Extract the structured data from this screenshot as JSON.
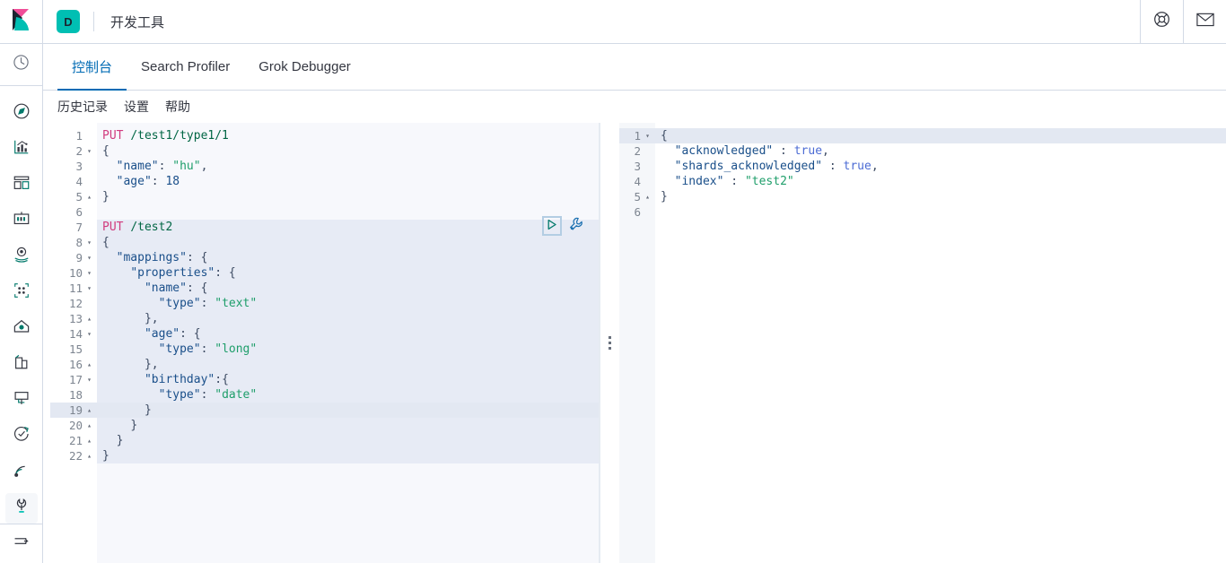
{
  "header": {
    "logo_icon": "kibana-logo-icon",
    "space_badge": "D",
    "app_title": "开发工具",
    "help_icon": "lifebuoy-help-icon",
    "mail_icon": "envelope-icon"
  },
  "sidebar": {
    "recent_icon": "clock-recently-viewed-icon",
    "items": [
      {
        "icon": "compass-discover-icon",
        "name": "discover"
      },
      {
        "icon": "bar-chart-visualize-icon",
        "name": "visualize"
      },
      {
        "icon": "dashboard-icon",
        "name": "dashboard"
      },
      {
        "icon": "canvas-icon",
        "name": "canvas"
      },
      {
        "icon": "map-pin-maps-icon",
        "name": "maps"
      },
      {
        "icon": "machine-learning-icon",
        "name": "machine-learning"
      },
      {
        "icon": "infrastructure-icon",
        "name": "infrastructure"
      },
      {
        "icon": "logs-icon",
        "name": "logs"
      },
      {
        "icon": "apm-icon",
        "name": "apm"
      },
      {
        "icon": "uptime-icon",
        "name": "uptime"
      },
      {
        "icon": "siem-icon",
        "name": "siem"
      },
      {
        "icon": "wrench-dev-tools-icon",
        "name": "dev-tools",
        "active": true
      }
    ],
    "collapse_icon": "collapse-arrow-icon"
  },
  "tabs": [
    {
      "label": "控制台",
      "active": true
    },
    {
      "label": "Search Profiler",
      "active": false
    },
    {
      "label": "Grok Debugger",
      "active": false
    }
  ],
  "subnav": [
    {
      "label": "历史记录"
    },
    {
      "label": "设置"
    },
    {
      "label": "帮助"
    }
  ],
  "editor": {
    "play_icon": "play-run-request-icon",
    "wrench_icon": "wrench-settings-icon",
    "active_line": 19,
    "selected_block": [
      7,
      22
    ],
    "lines": [
      {
        "n": 1,
        "fold": "",
        "tokens": [
          {
            "t": "PUT",
            "c": "k-method"
          },
          {
            "t": " ",
            "c": ""
          },
          {
            "t": "/test1/type1/1",
            "c": "k-url"
          }
        ]
      },
      {
        "n": 2,
        "fold": "▾",
        "tokens": [
          {
            "t": "{",
            "c": "k-punc"
          }
        ]
      },
      {
        "n": 3,
        "fold": "",
        "tokens": [
          {
            "t": "  ",
            "c": ""
          },
          {
            "t": "\"name\"",
            "c": "k-key"
          },
          {
            "t": ": ",
            "c": "k-punc"
          },
          {
            "t": "\"hu\"",
            "c": "k-strval"
          },
          {
            "t": ",",
            "c": "k-punc"
          }
        ]
      },
      {
        "n": 4,
        "fold": "",
        "tokens": [
          {
            "t": "  ",
            "c": ""
          },
          {
            "t": "\"age\"",
            "c": "k-key"
          },
          {
            "t": ": ",
            "c": "k-punc"
          },
          {
            "t": "18",
            "c": "k-num"
          }
        ]
      },
      {
        "n": 5,
        "fold": "▴",
        "tokens": [
          {
            "t": "}",
            "c": "k-punc"
          }
        ]
      },
      {
        "n": 6,
        "fold": "",
        "tokens": []
      },
      {
        "n": 7,
        "fold": "",
        "tokens": [
          {
            "t": "PUT",
            "c": "k-method"
          },
          {
            "t": " ",
            "c": ""
          },
          {
            "t": "/test2",
            "c": "k-url"
          }
        ]
      },
      {
        "n": 8,
        "fold": "▾",
        "tokens": [
          {
            "t": "{",
            "c": "k-punc"
          }
        ]
      },
      {
        "n": 9,
        "fold": "▾",
        "tokens": [
          {
            "t": "  ",
            "c": ""
          },
          {
            "t": "\"mappings\"",
            "c": "k-key"
          },
          {
            "t": ": ",
            "c": "k-punc"
          },
          {
            "t": "{",
            "c": "k-punc"
          }
        ]
      },
      {
        "n": 10,
        "fold": "▾",
        "tokens": [
          {
            "t": "    ",
            "c": ""
          },
          {
            "t": "\"properties\"",
            "c": "k-key"
          },
          {
            "t": ": ",
            "c": "k-punc"
          },
          {
            "t": "{",
            "c": "k-punc"
          }
        ]
      },
      {
        "n": 11,
        "fold": "▾",
        "tokens": [
          {
            "t": "      ",
            "c": ""
          },
          {
            "t": "\"name\"",
            "c": "k-key"
          },
          {
            "t": ": ",
            "c": "k-punc"
          },
          {
            "t": "{",
            "c": "k-punc"
          }
        ]
      },
      {
        "n": 12,
        "fold": "",
        "tokens": [
          {
            "t": "        ",
            "c": ""
          },
          {
            "t": "\"type\"",
            "c": "k-key"
          },
          {
            "t": ": ",
            "c": "k-punc"
          },
          {
            "t": "\"text\"",
            "c": "k-strval"
          }
        ]
      },
      {
        "n": 13,
        "fold": "▴",
        "tokens": [
          {
            "t": "      ",
            "c": ""
          },
          {
            "t": "},",
            "c": "k-punc"
          }
        ]
      },
      {
        "n": 14,
        "fold": "▾",
        "tokens": [
          {
            "t": "      ",
            "c": ""
          },
          {
            "t": "\"age\"",
            "c": "k-key"
          },
          {
            "t": ": ",
            "c": "k-punc"
          },
          {
            "t": "{",
            "c": "k-punc"
          }
        ]
      },
      {
        "n": 15,
        "fold": "",
        "tokens": [
          {
            "t": "        ",
            "c": ""
          },
          {
            "t": "\"type\"",
            "c": "k-key"
          },
          {
            "t": ": ",
            "c": "k-punc"
          },
          {
            "t": "\"long\"",
            "c": "k-strval"
          }
        ]
      },
      {
        "n": 16,
        "fold": "▴",
        "tokens": [
          {
            "t": "      ",
            "c": ""
          },
          {
            "t": "},",
            "c": "k-punc"
          }
        ]
      },
      {
        "n": 17,
        "fold": "▾",
        "tokens": [
          {
            "t": "      ",
            "c": ""
          },
          {
            "t": "\"birthday\"",
            "c": "k-key"
          },
          {
            "t": ":",
            "c": "k-punc"
          },
          {
            "t": "{",
            "c": "k-punc"
          }
        ]
      },
      {
        "n": 18,
        "fold": "",
        "tokens": [
          {
            "t": "        ",
            "c": ""
          },
          {
            "t": "\"type\"",
            "c": "k-key"
          },
          {
            "t": ": ",
            "c": "k-punc"
          },
          {
            "t": "\"date\"",
            "c": "k-strval"
          }
        ]
      },
      {
        "n": 19,
        "fold": "▴",
        "tokens": [
          {
            "t": "      ",
            "c": ""
          },
          {
            "t": "}",
            "c": "k-punc"
          }
        ]
      },
      {
        "n": 20,
        "fold": "▴",
        "tokens": [
          {
            "t": "    ",
            "c": ""
          },
          {
            "t": "}",
            "c": "k-punc"
          }
        ]
      },
      {
        "n": 21,
        "fold": "▴",
        "tokens": [
          {
            "t": "  ",
            "c": ""
          },
          {
            "t": "}",
            "c": "k-punc"
          }
        ]
      },
      {
        "n": 22,
        "fold": "▴",
        "tokens": [
          {
            "t": "}",
            "c": "k-punc"
          }
        ]
      }
    ]
  },
  "response": {
    "active_line": 1,
    "lines": [
      {
        "n": 1,
        "fold": "▾",
        "tokens": [
          {
            "t": "{",
            "c": "k-punc"
          }
        ]
      },
      {
        "n": 2,
        "fold": "",
        "tokens": [
          {
            "t": "  ",
            "c": ""
          },
          {
            "t": "\"acknowledged\"",
            "c": "k-key"
          },
          {
            "t": " : ",
            "c": "k-punc"
          },
          {
            "t": "true",
            "c": "k-bool"
          },
          {
            "t": ",",
            "c": "k-punc"
          }
        ]
      },
      {
        "n": 3,
        "fold": "",
        "tokens": [
          {
            "t": "  ",
            "c": ""
          },
          {
            "t": "\"shards_acknowledged\"",
            "c": "k-key"
          },
          {
            "t": " : ",
            "c": "k-punc"
          },
          {
            "t": "true",
            "c": "k-bool"
          },
          {
            "t": ",",
            "c": "k-punc"
          }
        ]
      },
      {
        "n": 4,
        "fold": "",
        "tokens": [
          {
            "t": "  ",
            "c": ""
          },
          {
            "t": "\"index\"",
            "c": "k-key"
          },
          {
            "t": " : ",
            "c": "k-punc"
          },
          {
            "t": "\"test2\"",
            "c": "k-strval"
          }
        ]
      },
      {
        "n": 5,
        "fold": "▴",
        "tokens": [
          {
            "t": "}",
            "c": "k-punc"
          }
        ]
      },
      {
        "n": 6,
        "fold": "",
        "tokens": []
      }
    ]
  },
  "resizer": {
    "grip_icon": "drag-handle-icon"
  },
  "colors": {
    "accent_blue": "#006BB4",
    "teal": "#00BFB3",
    "pink": "#F04E98",
    "border": "#d3dae6",
    "editor_bg": "#f7f8fc",
    "selection_bg": "#e7ebf5",
    "active_line_bg": "#e3e8f2"
  }
}
